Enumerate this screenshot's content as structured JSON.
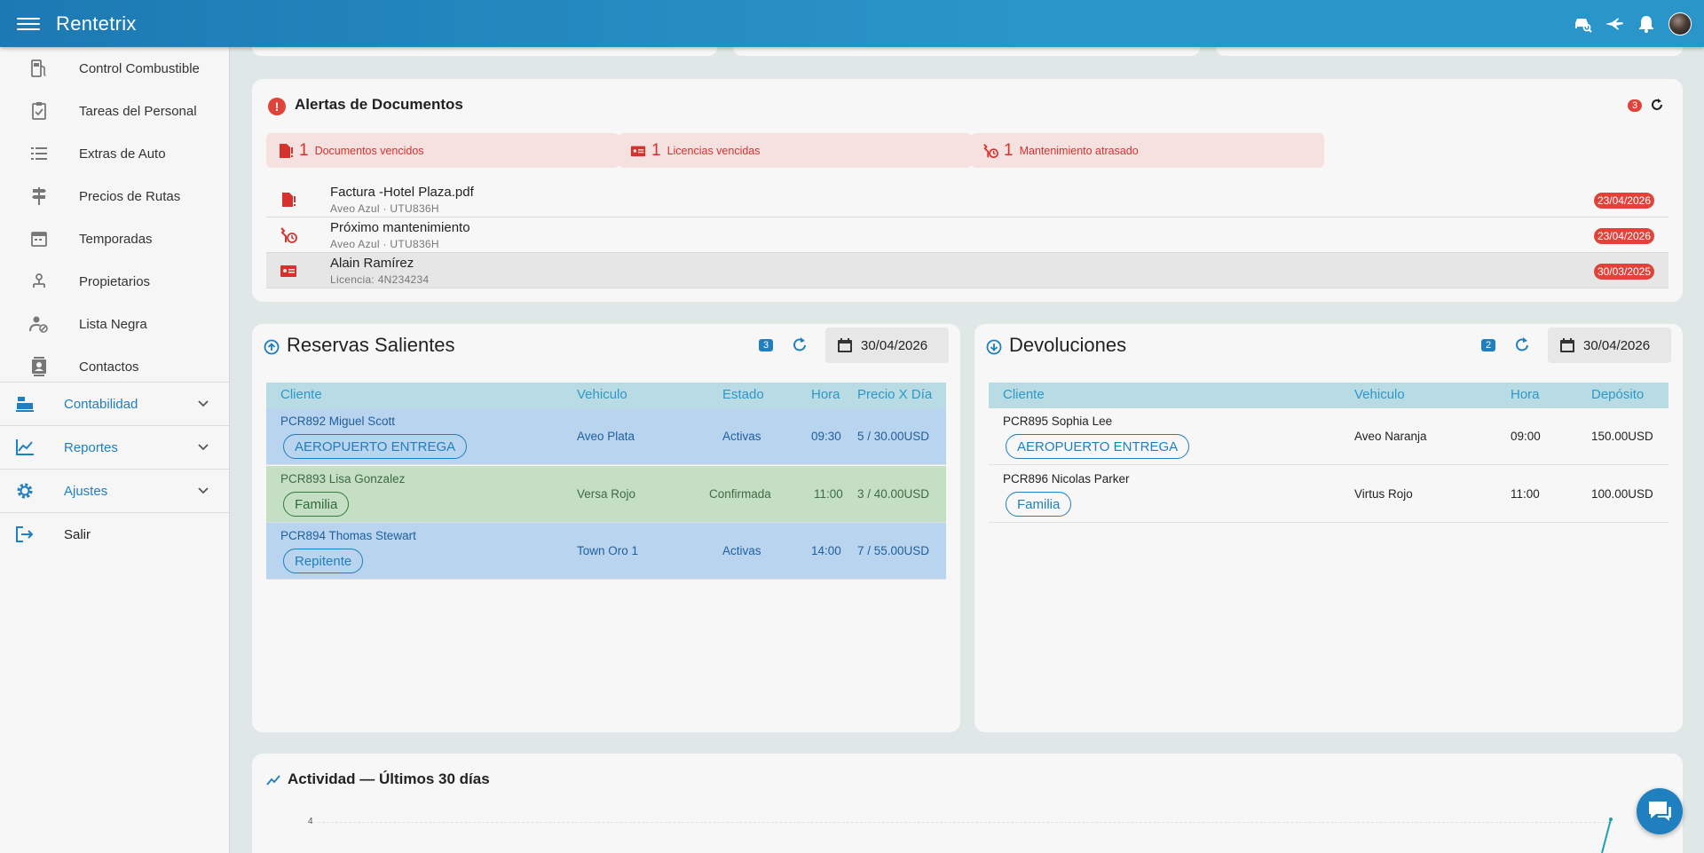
{
  "app": {
    "title": "Rentetrix"
  },
  "sidebar": {
    "items": [
      {
        "label": "Control Combustible",
        "icon": "fuel-pump-icon"
      },
      {
        "label": "Tareas del Personal",
        "icon": "clipboard-check-icon"
      },
      {
        "label": "Extras de Auto",
        "icon": "list-icon"
      },
      {
        "label": "Precios de Rutas",
        "icon": "signpost-icon"
      },
      {
        "label": "Temporadas",
        "icon": "calendar-icon"
      },
      {
        "label": "Propietarios",
        "icon": "person-tree-icon"
      },
      {
        "label": "Lista Negra",
        "icon": "person-block-icon"
      },
      {
        "label": "Contactos",
        "icon": "contacts-icon"
      }
    ],
    "groups": [
      {
        "label": "Contabilidad",
        "icon": "cash-register-icon"
      },
      {
        "label": "Reportes",
        "icon": "chart-line-icon"
      },
      {
        "label": "Ajustes",
        "icon": "gear-icon"
      }
    ],
    "logout": {
      "label": "Salir",
      "icon": "logout-icon"
    }
  },
  "alerts": {
    "title": "Alertas de Documentos",
    "count": "3",
    "pills": [
      {
        "count": "1",
        "label": "Documentos vencidos",
        "icon": "document-alert-icon"
      },
      {
        "count": "1",
        "label": "Licencias vencidas",
        "icon": "id-card-icon"
      },
      {
        "count": "1",
        "label": "Mantenimiento atrasado",
        "icon": "wrench-clock-icon"
      }
    ],
    "rows": [
      {
        "name": "Factura -Hotel Plaza.pdf",
        "sub": "Aveo Azul · UTU836H",
        "date": "23/04/2026",
        "icon": "document-alert-icon"
      },
      {
        "name": "Próximo mantenimiento",
        "sub": "Aveo Azul · UTU836H",
        "date": "23/04/2026",
        "icon": "wrench-clock-icon"
      },
      {
        "name": "Alain Ramírez",
        "sub": "Licencia: 4N234234",
        "date": "30/03/2025",
        "icon": "id-card-icon"
      }
    ]
  },
  "outgoing": {
    "title": "Reservas Salientes",
    "count": "3",
    "date": "30/04/2026",
    "headers": [
      "Cliente",
      "Vehiculo",
      "Estado",
      "Hora",
      "Precio X Día"
    ],
    "rows": [
      {
        "client": "PCR892 Miguel Scott",
        "tag": "AEROPUERTO ENTREGA",
        "vehicle": "Aveo Plata",
        "status": "Activas",
        "time": "09:30",
        "price": "5 / 30.00USD",
        "color": "#b8d4ee"
      },
      {
        "client": "PCR893 Lisa Gonzalez",
        "tag": "Familia",
        "vehicle": "Versa Rojo",
        "status": "Confirmada",
        "time": "11:00",
        "price": "3 / 40.00USD",
        "color": "#c5dfc4"
      },
      {
        "client": "PCR894 Thomas Stewart",
        "tag": "Repitente",
        "vehicle": "Town Oro 1",
        "status": "Activas",
        "time": "14:00",
        "price": "7 / 55.00USD",
        "color": "#b8d4ee"
      }
    ]
  },
  "returns": {
    "title": "Devoluciones",
    "count": "2",
    "date": "30/04/2026",
    "headers": [
      "Cliente",
      "Vehiculo",
      "Hora",
      "Depósito"
    ],
    "rows": [
      {
        "client": "PCR895 Sophia Lee",
        "tag": "AEROPUERTO ENTREGA",
        "vehicle": "Aveo Naranja",
        "time": "09:00",
        "deposit": "150.00USD"
      },
      {
        "client": "PCR896 Nicolas Parker",
        "tag": "Familia",
        "vehicle": "Virtus Rojo",
        "time": "11:00",
        "deposit": "100.00USD"
      }
    ]
  },
  "activity": {
    "title": "Actividad — Últimos 30 días",
    "y_tick": "4"
  },
  "colors": {
    "primary": "#1f7fbf",
    "alert": "#e0433a",
    "topbar": "#2a95c9"
  }
}
